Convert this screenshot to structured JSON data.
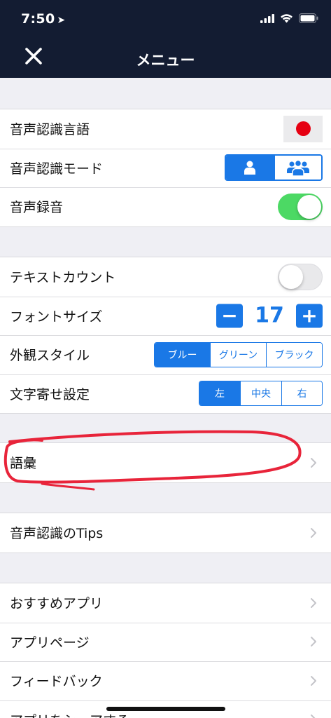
{
  "status": {
    "time": "7:50",
    "icons": [
      "location-arrow-icon",
      "signal-icon",
      "wifi-icon",
      "battery-icon"
    ]
  },
  "header": {
    "title": "メニュー",
    "close_icon": "close-icon"
  },
  "section1": {
    "language_label": "音声認識言語",
    "mode_label": "音声認識モード",
    "record_label": "音声録音",
    "record_on": true
  },
  "section2": {
    "text_count_label": "テキストカウント",
    "text_count_on": false,
    "font_size_label": "フォントサイズ",
    "font_size_value": "17",
    "minus_label": "−",
    "plus_label": "+",
    "style_label": "外観スタイル",
    "style_options": [
      "ブルー",
      "グリーン",
      "ブラック"
    ],
    "align_label": "文字寄せ設定",
    "align_options": [
      "左",
      "中央",
      "右"
    ]
  },
  "section3": {
    "vocabulary_label": "語彙"
  },
  "section4": {
    "tips_label": "音声認識のTips"
  },
  "section5": {
    "recommended_apps_label": "おすすめアプリ",
    "app_page_label": "アプリページ",
    "feedback_label": "フィードバック",
    "share_label": "アプリをシェアする"
  },
  "colors": {
    "header_bg": "#131c32",
    "accent": "#1a78e6",
    "toggle_on": "#4cd964",
    "flag_red": "#e60012",
    "annotation": "#e8243a"
  }
}
